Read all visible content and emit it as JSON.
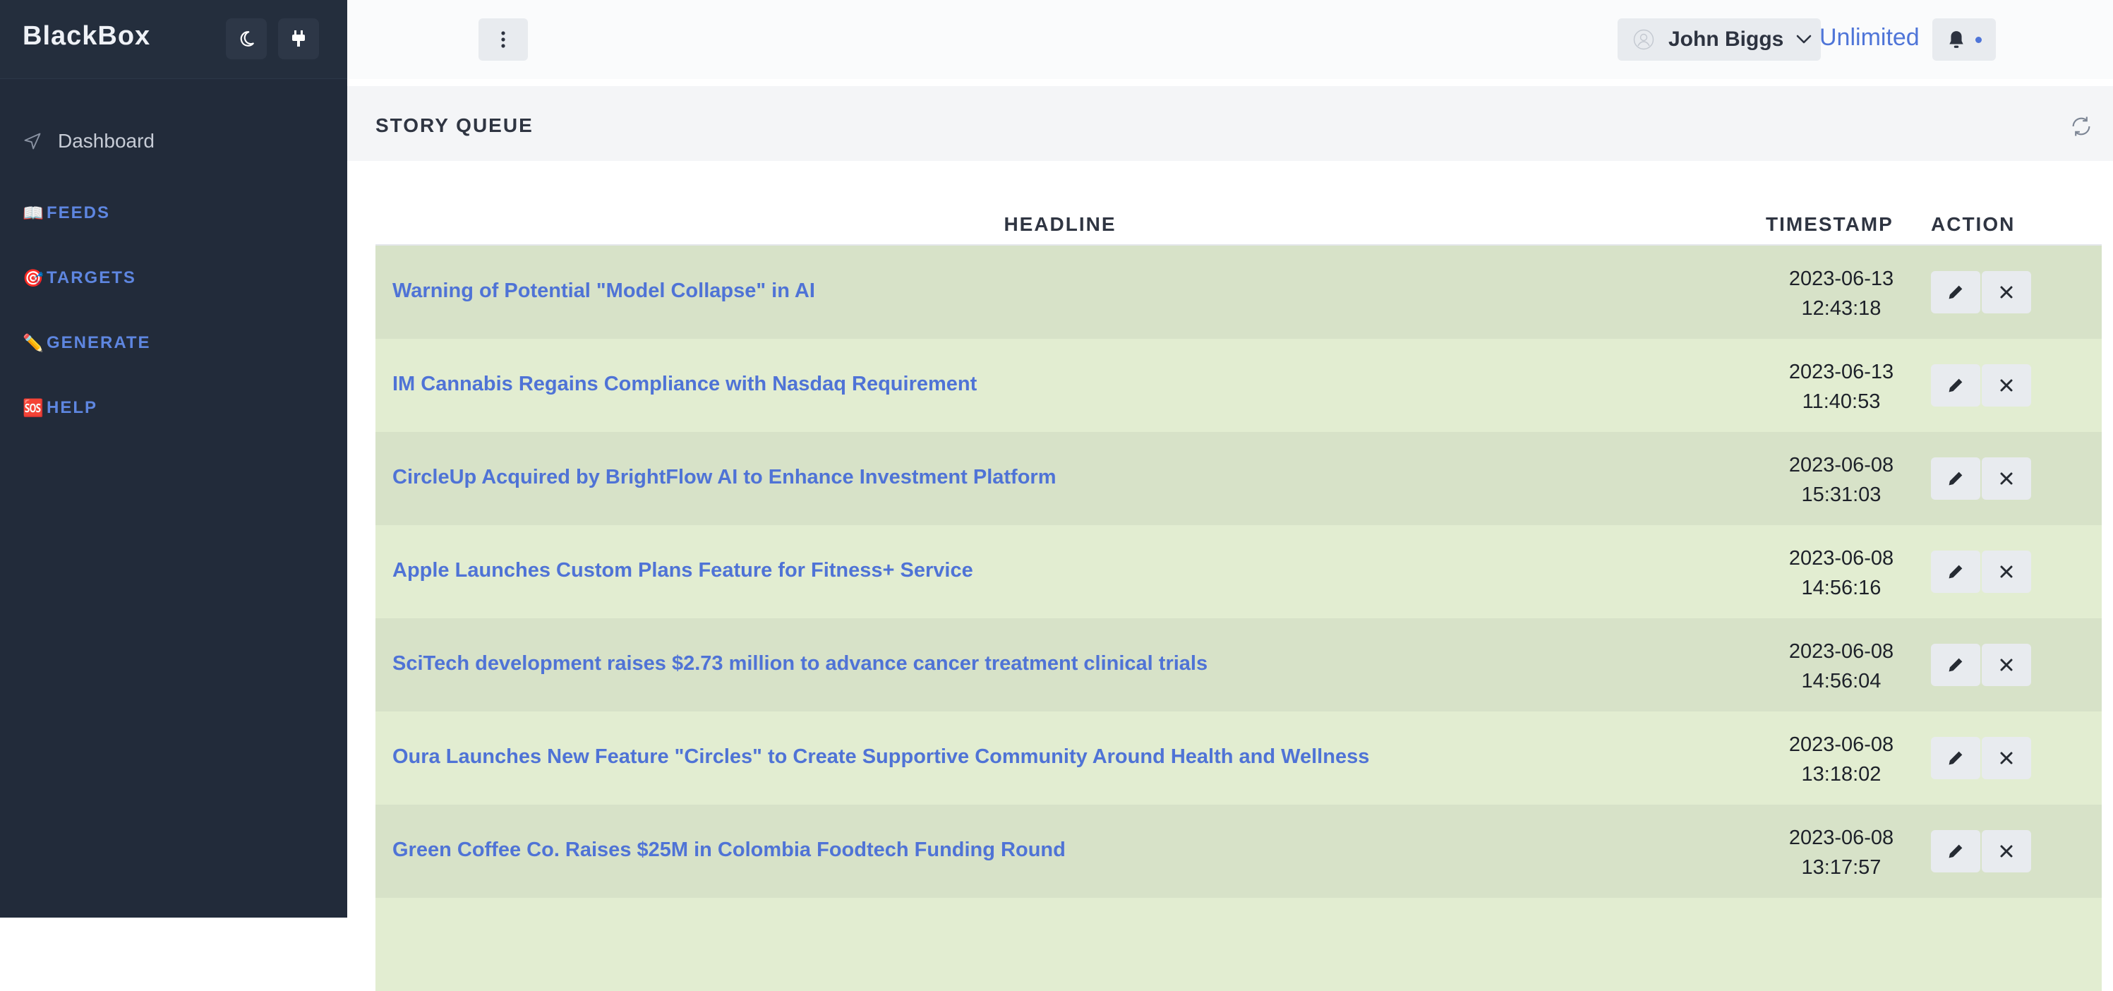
{
  "app": {
    "brand": "BlackBox"
  },
  "sidebar": {
    "dashboard_label": "Dashboard",
    "items": [
      {
        "emoji": "📖",
        "label": "FEEDS",
        "icon": "book-icon"
      },
      {
        "emoji": "🎯",
        "label": "TARGETS",
        "icon": "target-icon"
      },
      {
        "emoji": "✏️",
        "label": "GENERATE",
        "icon": "pencil-icon"
      },
      {
        "emoji": "🆘",
        "label": "HELP",
        "icon": "sos-icon"
      }
    ]
  },
  "topbar": {
    "user_name": "John Biggs",
    "plan_label": "Unlimited"
  },
  "section": {
    "title": "STORY QUEUE"
  },
  "table": {
    "headers": {
      "headline": "HEADLINE",
      "timestamp": "TIMESTAMP",
      "action": "ACTION"
    },
    "rows": [
      {
        "headline": "Warning of Potential \"Model Collapse\" in AI",
        "date": "2023-06-13",
        "time": "12:43:18"
      },
      {
        "headline": "IM Cannabis Regains Compliance with Nasdaq Requirement",
        "date": "2023-06-13",
        "time": "11:40:53"
      },
      {
        "headline": "CircleUp Acquired by BrightFlow AI to Enhance Investment Platform",
        "date": "2023-06-08",
        "time": "15:31:03"
      },
      {
        "headline": "Apple Launches Custom Plans Feature for Fitness+ Service",
        "date": "2023-06-08",
        "time": "14:56:16"
      },
      {
        "headline": "SciTech development raises $2.73 million to advance cancer treatment clinical trials",
        "date": "2023-06-08",
        "time": "14:56:04"
      },
      {
        "headline": "Oura Launches New Feature \"Circles\" to Create Supportive Community Around Health and Wellness",
        "date": "2023-06-08",
        "time": "13:18:02"
      },
      {
        "headline": "Green Coffee Co. Raises $25M in Colombia Foodtech Funding Round",
        "date": "2023-06-08",
        "time": "13:17:57"
      }
    ]
  },
  "colors": {
    "sidebar_bg": "#222b3a",
    "accent": "#4f75d8",
    "row_odd": "#d7e2c8",
    "row_even": "#e2edd1"
  }
}
